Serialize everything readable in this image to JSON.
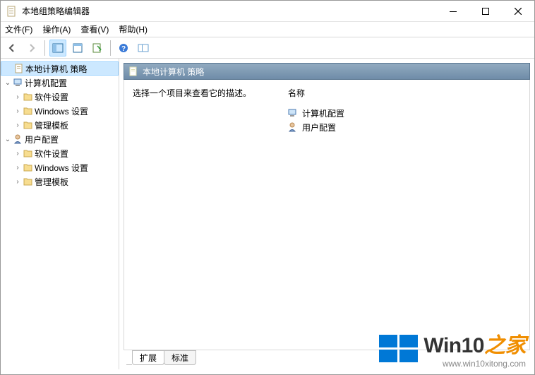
{
  "window": {
    "title": "本地组策略编辑器"
  },
  "menu": {
    "file": "文件(F)",
    "action": "操作(A)",
    "view": "查看(V)",
    "help": "帮助(H)"
  },
  "tree": {
    "root": "本地计算机 策略",
    "computer_cfg": "计算机配置",
    "user_cfg": "用户配置",
    "software_settings": "软件设置",
    "windows_settings": "Windows 设置",
    "admin_templates": "管理模板"
  },
  "pane": {
    "header": "本地计算机 策略",
    "description": "选择一个项目来查看它的描述。",
    "col_name": "名称",
    "items": {
      "computer": "计算机配置",
      "user": "用户配置"
    }
  },
  "tabs": {
    "extended": "扩展",
    "standard": "标准"
  },
  "watermark": {
    "prefix": "Win10",
    "suffix": "之家",
    "url": "www.win10xitong.com"
  }
}
